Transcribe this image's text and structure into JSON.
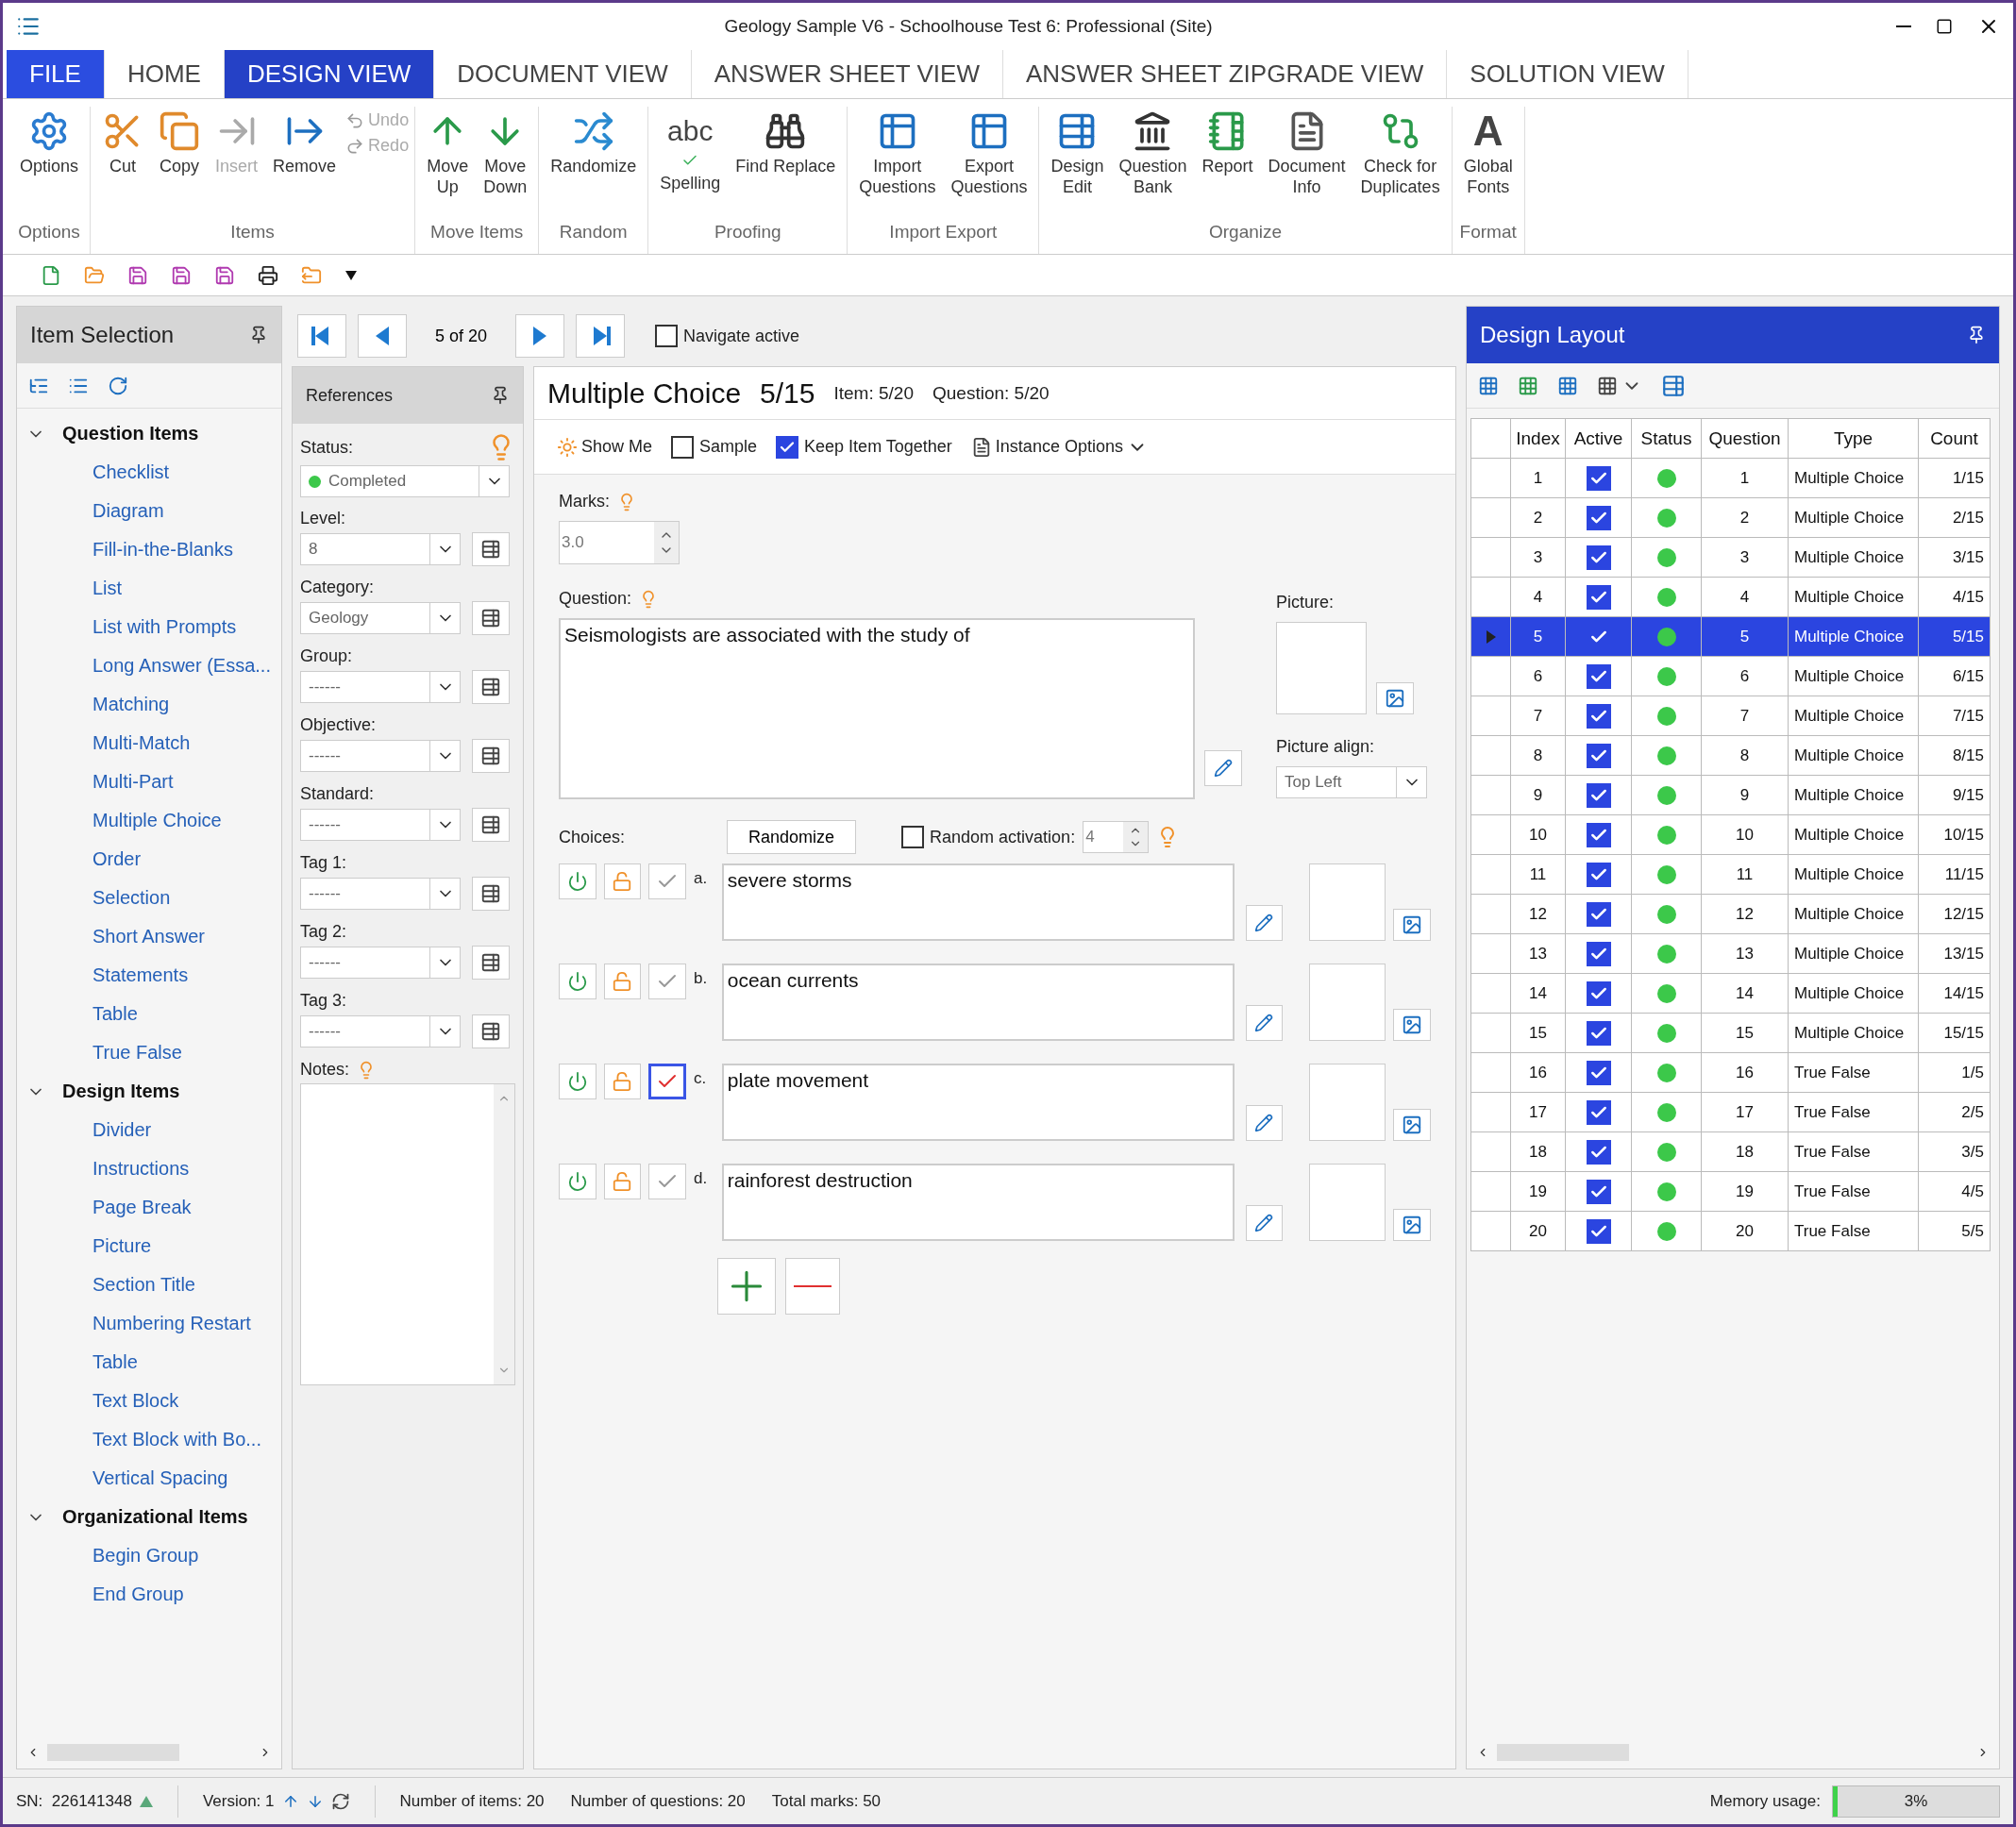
{
  "window": {
    "title": "Geology Sample V6 - Schoolhouse Test 6: Professional (Site)"
  },
  "file_menu": "FILE",
  "tabs": [
    {
      "label": "HOME",
      "kind": "tab",
      "selected": false
    },
    {
      "label": "DESIGN VIEW",
      "kind": "tab",
      "selected": true
    },
    {
      "label": "DOCUMENT VIEW",
      "kind": "tab",
      "selected": false
    },
    {
      "label": "ANSWER SHEET VIEW",
      "kind": "tab",
      "selected": false
    },
    {
      "label": "ANSWER SHEET ZIPGRADE VIEW",
      "kind": "tab",
      "selected": false
    },
    {
      "label": "SOLUTION VIEW",
      "kind": "tab",
      "selected": false
    }
  ],
  "ribbon": [
    {
      "label": "Options",
      "buttons": [
        {
          "label": "Options",
          "kind": "large",
          "disabled": false
        }
      ]
    },
    {
      "label": "Items",
      "buttons": [
        {
          "label": "Cut",
          "kind": "large",
          "disabled": false
        },
        {
          "label": "Copy",
          "kind": "large",
          "disabled": false
        },
        {
          "label": "Insert",
          "kind": "large",
          "disabled": true
        },
        {
          "label": "Remove",
          "kind": "large",
          "disabled": false
        },
        {
          "label": "Undo",
          "kind": "small",
          "disabled": true
        },
        {
          "label": "Redo",
          "kind": "small",
          "disabled": true
        }
      ]
    },
    {
      "label": "Move Items",
      "buttons": [
        {
          "label": "Move\nUp",
          "kind": "large",
          "disabled": false
        },
        {
          "label": "Move\nDown",
          "kind": "large",
          "disabled": false
        }
      ]
    },
    {
      "label": "Random",
      "buttons": [
        {
          "label": "Randomize",
          "kind": "large",
          "disabled": false
        }
      ]
    },
    {
      "label": "Proofing",
      "buttons": [
        {
          "label": "Spelling",
          "kind": "large",
          "disabled": false,
          "glyph": "abc"
        },
        {
          "label": "Find Replace",
          "kind": "large",
          "disabled": false
        }
      ]
    },
    {
      "label": "Import Export",
      "buttons": [
        {
          "label": "Import\nQuestions",
          "kind": "large",
          "disabled": false
        },
        {
          "label": "Export\nQuestions",
          "kind": "large",
          "disabled": false
        }
      ]
    },
    {
      "label": "Organize",
      "buttons": [
        {
          "label": "Design\nEdit",
          "kind": "large",
          "disabled": false
        },
        {
          "label": "Question\nBank",
          "kind": "large",
          "disabled": false
        },
        {
          "label": "Report",
          "kind": "large",
          "disabled": false
        },
        {
          "label": "Document\nInfo",
          "kind": "large",
          "disabled": false
        },
        {
          "label": "Check for\nDuplicates",
          "kind": "large",
          "disabled": false
        }
      ]
    },
    {
      "label": "Format",
      "buttons": [
        {
          "label": "Global\nFonts",
          "kind": "large",
          "disabled": false,
          "glyph": "A"
        }
      ]
    }
  ],
  "item_selection": {
    "title": "Item Selection",
    "categories": [
      {
        "label": "Question Items",
        "expanded": true,
        "children": [
          {
            "label": "Checklist"
          },
          {
            "label": "Diagram"
          },
          {
            "label": "Fill-in-the-Blanks"
          },
          {
            "label": "List"
          },
          {
            "label": "List with Prompts"
          },
          {
            "label": "Long Answer (Essa..."
          },
          {
            "label": "Matching"
          },
          {
            "label": "Multi-Match"
          },
          {
            "label": "Multi-Part"
          },
          {
            "label": "Multiple Choice"
          },
          {
            "label": "Order"
          },
          {
            "label": "Selection"
          },
          {
            "label": "Short Answer"
          },
          {
            "label": "Statements"
          },
          {
            "label": "Table"
          },
          {
            "label": "True False"
          }
        ]
      },
      {
        "label": "Design Items",
        "expanded": true,
        "children": [
          {
            "label": "Divider"
          },
          {
            "label": "Instructions"
          },
          {
            "label": "Page Break"
          },
          {
            "label": "Picture"
          },
          {
            "label": "Section Title"
          },
          {
            "label": "Numbering Restart"
          },
          {
            "label": "Table"
          },
          {
            "label": "Text Block"
          },
          {
            "label": "Text Block with Bo..."
          },
          {
            "label": "Vertical Spacing"
          }
        ]
      },
      {
        "label": "Organizational Items",
        "expanded": true,
        "children": [
          {
            "label": "Begin Group"
          },
          {
            "label": "End Group"
          }
        ]
      }
    ]
  },
  "navigator": {
    "position": "5 of 20",
    "navigate_active": {
      "label": "Navigate active",
      "checked": false
    }
  },
  "references": {
    "title": "References",
    "fields": [
      {
        "label": "Status:",
        "kind": "status",
        "value": "Completed",
        "color": "#3cc84a"
      },
      {
        "label": "Level:",
        "kind": "select",
        "value": "8"
      },
      {
        "label": "Category:",
        "kind": "select",
        "value": "Geology"
      },
      {
        "label": "Group:",
        "kind": "select",
        "value": "------"
      },
      {
        "label": "Objective:",
        "kind": "select",
        "value": "------"
      },
      {
        "label": "Standard:",
        "kind": "select",
        "value": "------"
      },
      {
        "label": "Tag 1:",
        "kind": "select",
        "value": "------"
      },
      {
        "label": "Tag 2:",
        "kind": "select",
        "value": "------"
      },
      {
        "label": "Tag 3:",
        "kind": "select",
        "value": "------"
      }
    ],
    "notes_label": "Notes:"
  },
  "editor": {
    "type": "Multiple Choice",
    "count": "5/15",
    "item": "Item: 5/20",
    "question_number": "Question: 5/20",
    "show_me": "Show Me",
    "sample": {
      "label": "Sample",
      "checked": false
    },
    "keep_together": {
      "label": "Keep Item Together",
      "checked": true
    },
    "instance_options": "Instance Options",
    "marks_label": "Marks:",
    "marks": "3.0",
    "question_label": "Question:",
    "question_text": "Seismologists are associated with the study of",
    "picture_label": "Picture:",
    "picture_align_label": "Picture align:",
    "picture_align": "Top Left",
    "choices_label": "Choices:",
    "randomize": "Randomize",
    "random_activation": {
      "label": "Random activation:",
      "checked": false,
      "value": "4"
    },
    "choices": [
      {
        "letter": "a.",
        "text": "severe storms",
        "correct": false
      },
      {
        "letter": "b.",
        "text": "ocean currents",
        "correct": false
      },
      {
        "letter": "c.",
        "text": "plate movement",
        "correct": true
      },
      {
        "letter": "d.",
        "text": "rainforest destruction",
        "correct": false
      }
    ]
  },
  "design_layout": {
    "title": "Design Layout",
    "columns": [
      "Index",
      "Active",
      "Status",
      "Question",
      "Type",
      "Count"
    ],
    "rows": [
      {
        "index": "1",
        "active": true,
        "color": "#3cc84a",
        "question": "1",
        "type": "Multiple Choice",
        "count": "1/15",
        "selected": false
      },
      {
        "index": "2",
        "active": true,
        "color": "#3cc84a",
        "question": "2",
        "type": "Multiple Choice",
        "count": "2/15",
        "selected": false
      },
      {
        "index": "3",
        "active": true,
        "color": "#3cc84a",
        "question": "3",
        "type": "Multiple Choice",
        "count": "3/15",
        "selected": false
      },
      {
        "index": "4",
        "active": true,
        "color": "#3cc84a",
        "question": "4",
        "type": "Multiple Choice",
        "count": "4/15",
        "selected": false
      },
      {
        "index": "5",
        "active": true,
        "color": "#3cc84a",
        "question": "5",
        "type": "Multiple Choice",
        "count": "5/15",
        "selected": true
      },
      {
        "index": "6",
        "active": true,
        "color": "#3cc84a",
        "question": "6",
        "type": "Multiple Choice",
        "count": "6/15",
        "selected": false
      },
      {
        "index": "7",
        "active": true,
        "color": "#3cc84a",
        "question": "7",
        "type": "Multiple Choice",
        "count": "7/15",
        "selected": false
      },
      {
        "index": "8",
        "active": true,
        "color": "#3cc84a",
        "question": "8",
        "type": "Multiple Choice",
        "count": "8/15",
        "selected": false
      },
      {
        "index": "9",
        "active": true,
        "color": "#3cc84a",
        "question": "9",
        "type": "Multiple Choice",
        "count": "9/15",
        "selected": false
      },
      {
        "index": "10",
        "active": true,
        "color": "#3cc84a",
        "question": "10",
        "type": "Multiple Choice",
        "count": "10/15",
        "selected": false
      },
      {
        "index": "11",
        "active": true,
        "color": "#3cc84a",
        "question": "11",
        "type": "Multiple Choice",
        "count": "11/15",
        "selected": false
      },
      {
        "index": "12",
        "active": true,
        "color": "#3cc84a",
        "question": "12",
        "type": "Multiple Choice",
        "count": "12/15",
        "selected": false
      },
      {
        "index": "13",
        "active": true,
        "color": "#3cc84a",
        "question": "13",
        "type": "Multiple Choice",
        "count": "13/15",
        "selected": false
      },
      {
        "index": "14",
        "active": true,
        "color": "#3cc84a",
        "question": "14",
        "type": "Multiple Choice",
        "count": "14/15",
        "selected": false
      },
      {
        "index": "15",
        "active": true,
        "color": "#3cc84a",
        "question": "15",
        "type": "Multiple Choice",
        "count": "15/15",
        "selected": false
      },
      {
        "index": "16",
        "active": true,
        "color": "#3cc84a",
        "question": "16",
        "type": "True False",
        "count": "1/5",
        "selected": false
      },
      {
        "index": "17",
        "active": true,
        "color": "#3cc84a",
        "question": "17",
        "type": "True False",
        "count": "2/5",
        "selected": false
      },
      {
        "index": "18",
        "active": true,
        "color": "#3cc84a",
        "question": "18",
        "type": "True False",
        "count": "3/5",
        "selected": false
      },
      {
        "index": "19",
        "active": true,
        "color": "#3cc84a",
        "question": "19",
        "type": "True False",
        "count": "4/5",
        "selected": false
      },
      {
        "index": "20",
        "active": true,
        "color": "#3cc84a",
        "question": "20",
        "type": "True False",
        "count": "5/5",
        "selected": false
      }
    ]
  },
  "status_bar": {
    "serial": "SN:  226141348",
    "version": "Version: 1",
    "items": "Number of items: 20",
    "questions": "Number of questions: 20",
    "marks": "Total marks: 50",
    "memory_label": "Memory usage:",
    "memory": {
      "level": 0.03,
      "reading": "3%"
    }
  }
}
